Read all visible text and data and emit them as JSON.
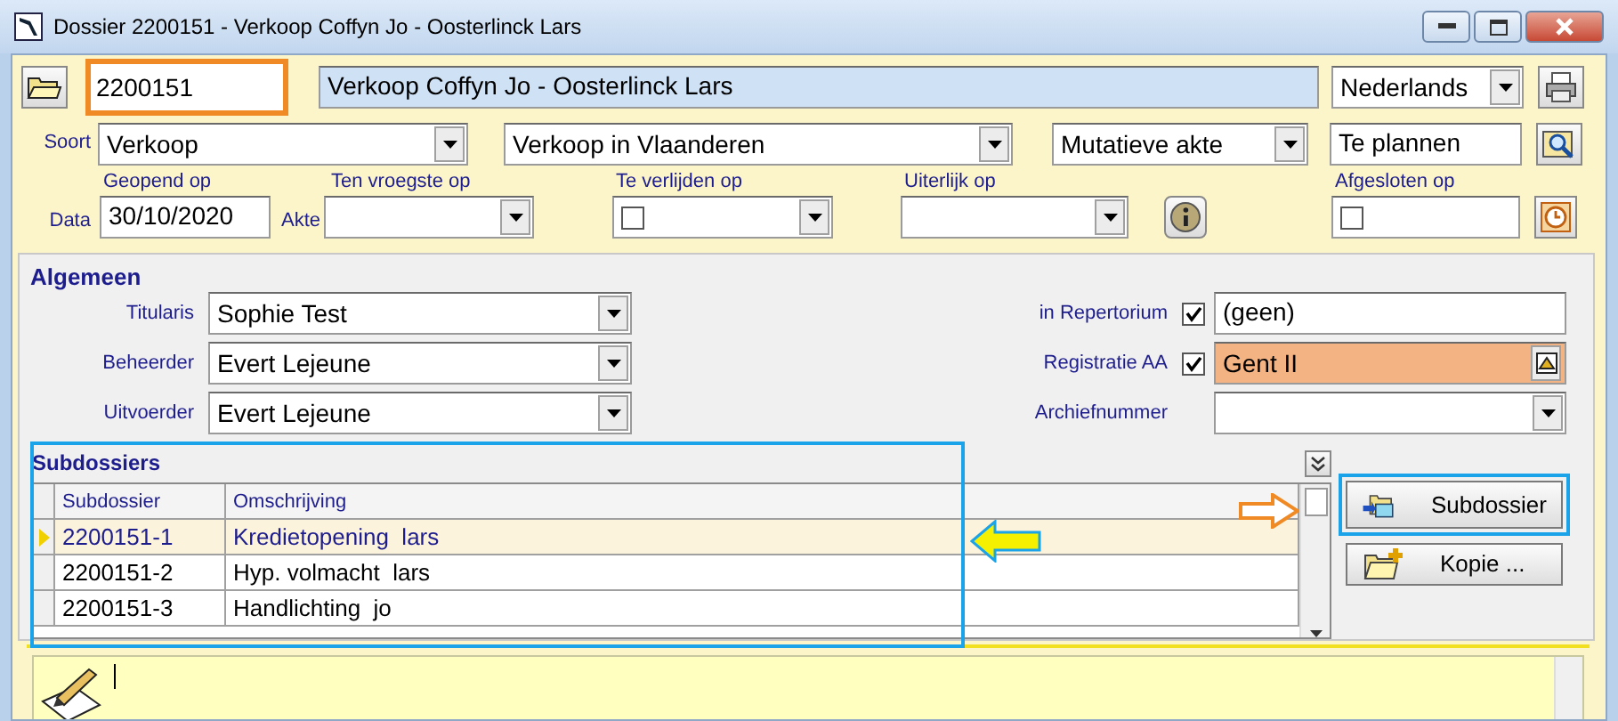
{
  "window": {
    "title": "Dossier 2200151 - Verkoop Coffyn Jo - Oosterlinck Lars"
  },
  "header": {
    "dossier_number": "2200151",
    "description": "Verkoop Coffyn Jo - Oosterlinck Lars",
    "language": "Nederlands"
  },
  "soort": {
    "label": "Soort",
    "values": [
      "Verkoop",
      "Verkoop in Vlaanderen",
      "Mutatieve akte"
    ],
    "status": "Te plannen"
  },
  "dates": {
    "label": "Data",
    "akte_label": "Akte",
    "fields": [
      {
        "label": "Geopend op",
        "kind": "text",
        "value": "30/10/2020"
      },
      {
        "label": "Ten vroegste op",
        "kind": "select"
      },
      {
        "label": "Te verlijden op",
        "kind": "checkselect",
        "checked": false
      },
      {
        "label": "Uiterlijk op",
        "kind": "select"
      },
      {
        "label": "Afgesloten op",
        "kind": "checktext",
        "checked": false
      }
    ]
  },
  "algemeen": {
    "title": "Algemeen",
    "left": [
      {
        "label": "Titularis",
        "value": "Sophie Test"
      },
      {
        "label": "Beheerder",
        "value": "Evert Lejeune"
      },
      {
        "label": "Uitvoerder",
        "value": "Evert Lejeune"
      }
    ],
    "right": [
      {
        "label": "in Repertorium",
        "checked": true,
        "kind": "text",
        "value": "(geen)"
      },
      {
        "label": "Registratie AA",
        "checked": true,
        "kind": "lookup",
        "value": "Gent II"
      },
      {
        "label": "Archiefnummer",
        "kind": "select"
      }
    ]
  },
  "subdossiers": {
    "title": "Subdossiers",
    "columns": [
      "Subdossier",
      "Omschrijving"
    ],
    "rows": [
      {
        "cells": [
          "2200151-1",
          "Kredietopening  lars"
        ],
        "selected": true
      },
      {
        "cells": [
          "2200151-2",
          "Hyp. volmacht  lars"
        ],
        "selected": false
      },
      {
        "cells": [
          "2200151-3",
          "Handlichting  jo"
        ],
        "selected": false
      }
    ],
    "buttons": [
      {
        "kind": "open",
        "label": "Subdossier"
      },
      {
        "kind": "copy",
        "label": "Kopie ..."
      }
    ]
  }
}
